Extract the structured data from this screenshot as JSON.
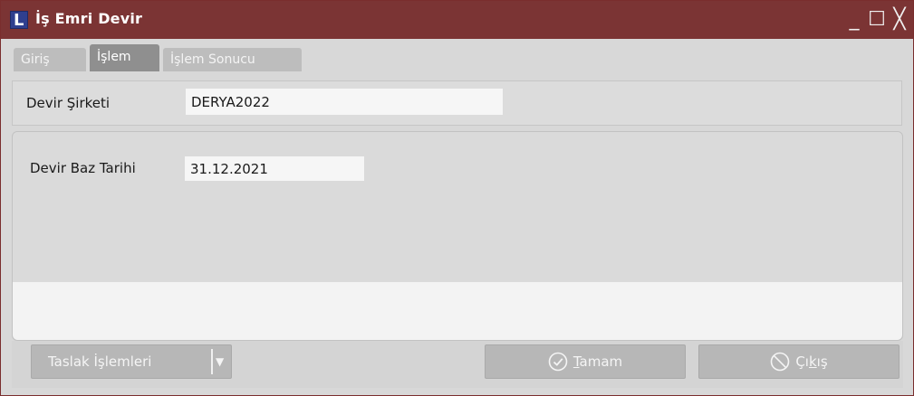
{
  "window": {
    "title": "İş Emri Devir",
    "logo_letter": "L",
    "minimize_glyph": "_",
    "maximize_glyph": "☐",
    "close_glyph": "╳"
  },
  "tabs": [
    {
      "label": "Giriş",
      "active": false
    },
    {
      "label": "İşlem",
      "active": true
    },
    {
      "label": "İşlem Sonucu",
      "active": false
    }
  ],
  "form": {
    "devir_sirketi": {
      "label": "Devir Şirketi",
      "value": "DERYA2022"
    },
    "devir_baz_tarihi": {
      "label": "Devir Baz Tarihi",
      "value": "31.12.2021"
    }
  },
  "buttons": {
    "taslak": {
      "label": "Taslak İşlemleri",
      "caret": "▼"
    },
    "tamam": {
      "accel": "T",
      "rest": "amam",
      "icon": "check-circle-icon"
    },
    "cikis": {
      "pre": "Çı",
      "accel": "k",
      "rest": "ış",
      "icon": "no-entry-icon"
    }
  },
  "colors": {
    "titlebar": "#7b3434",
    "active_tab": "#8f8f8f",
    "inactive_tab": "#bdbdbd",
    "button": "#b7b7b7"
  }
}
